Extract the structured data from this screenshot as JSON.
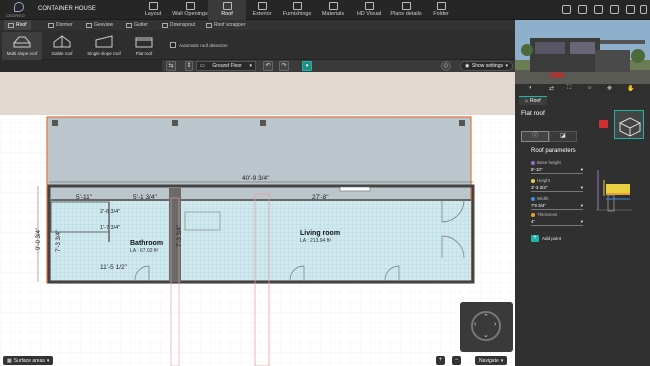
{
  "app": {
    "logo_text": "CEDREO",
    "project_title": "CONTAINER HOUSE"
  },
  "main_tabs": [
    {
      "label": "Layout",
      "icon": "layout-icon"
    },
    {
      "label": "Wall Openings",
      "icon": "door-icon"
    },
    {
      "label": "Roof",
      "icon": "roof-icon",
      "active": true
    },
    {
      "label": "Exterior",
      "icon": "tree-icon"
    },
    {
      "label": "Furnishings",
      "icon": "sofa-icon"
    },
    {
      "label": "Materials",
      "icon": "paint-icon"
    },
    {
      "label": "HD Visual",
      "icon": "camera-icon"
    },
    {
      "label": "Plans details",
      "icon": "plan-icon"
    },
    {
      "label": "Folder",
      "icon": "folder-icon"
    }
  ],
  "sub_tabs": [
    {
      "label": "Roof",
      "active": true
    },
    {
      "label": "Dormer"
    },
    {
      "label": "Gesview"
    },
    {
      "label": "Gutter"
    },
    {
      "label": "Downspout"
    },
    {
      "label": "Roof scrapper"
    }
  ],
  "roof_types": [
    {
      "label": "Multi slope roof",
      "active": true
    },
    {
      "label": "Gable roof"
    },
    {
      "label": "Single slope roof"
    },
    {
      "label": "Flat roof"
    }
  ],
  "auto_detection_label": "Automatic roof detection",
  "floor_select": "Ground Floor",
  "show_settings": "Show settings",
  "plan": {
    "dim_overall": "40'-9 3/4\"",
    "dim_5_11": "5'-11\"",
    "dim_5_1_3_4": "5'-1 3/4\"",
    "dim_27_8": "27'-8\"",
    "dim_2_6": "2'-6 3/4\"",
    "dim_1_7": "1'-7 3/4\"",
    "dim_9_0": "9'-0 3/4\"",
    "dim_7_3": "7'-3 3/4\"",
    "dim_7_3b": "7'-3 3/4\"",
    "dim_11_5": "11'-5 1/2\"",
    "bathroom_name": "Bathroom",
    "bathroom_area": "LA : 67.03 ft²",
    "living_name": "Living room",
    "living_area": "LA : 213.94 ft²"
  },
  "bottom": {
    "surface_areas": "Surface areas",
    "navigate": "Navigate"
  },
  "panel": {
    "tab_label": "Roof",
    "title": "Flat roof",
    "params_title": "Roof parameters",
    "params": [
      {
        "label": "Base height",
        "value": "8'-10\"",
        "color": "#9b6fd1"
      },
      {
        "label": "Height",
        "value": "3'-3 3/4\"",
        "color": "#e8d040"
      },
      {
        "label": "Width",
        "value": "7'9 3/4\"",
        "color": "#3a8de0"
      },
      {
        "label": "Thickness",
        "value": "4\"",
        "color": "#e8a030"
      }
    ],
    "add_point": "Add point"
  },
  "colors": {
    "accent": "#1fb5a8",
    "roof_outline": "#e8733a",
    "canvas_bg": "#ffffff"
  }
}
